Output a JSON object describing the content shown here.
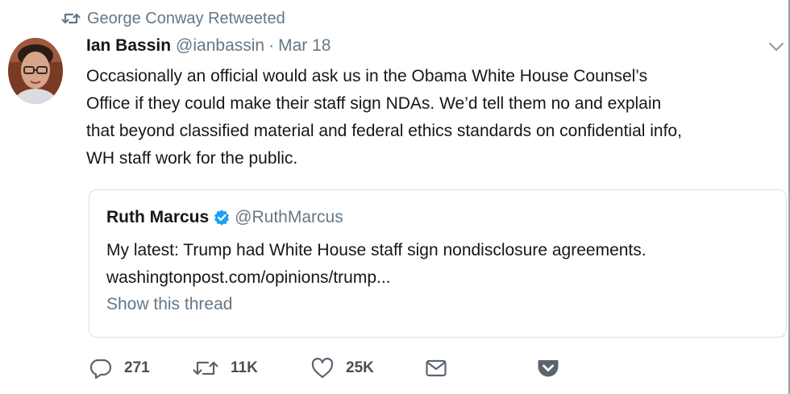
{
  "retweet": {
    "icon": "retweet-icon",
    "text": "George Conway Retweeted"
  },
  "tweet": {
    "name": "Ian Bassin",
    "handle": "@ianbassin",
    "separator": "·",
    "date": "Mar 18",
    "lines": [
      "Occasionally an official would ask us in the Obama White House Counsel’s",
      "Office if they could make their staff sign NDAs. We’d tell them no and explain",
      "that beyond classified material and federal ethics standards on confidential info,",
      "WH staff work for the public."
    ],
    "menu_icon": "chevron-down-icon"
  },
  "quoted_tweet": {
    "name": "Ruth Marcus",
    "verified_icon": "verified-badge-icon",
    "handle": "@RuthMarcus",
    "lines": [
      "My latest: Trump had White House staff sign nondisclosure agreements.",
      "washingtonpost.com/opinions/trump..."
    ],
    "thread_link": "Show this thread"
  },
  "actions": {
    "reply": {
      "icon": "reply-icon",
      "count": "271"
    },
    "retweet": {
      "icon": "retweet-icon",
      "count": "11K"
    },
    "like": {
      "icon": "heart-icon",
      "count": "25K"
    },
    "dm": {
      "icon": "envelope-icon"
    },
    "pocket": {
      "icon": "pocket-icon"
    }
  },
  "colors": {
    "text": "#14171a",
    "muted": "#657786",
    "verified": "#1da1f2",
    "border": "#d8dfe4",
    "action_icon": "#5b6570"
  }
}
